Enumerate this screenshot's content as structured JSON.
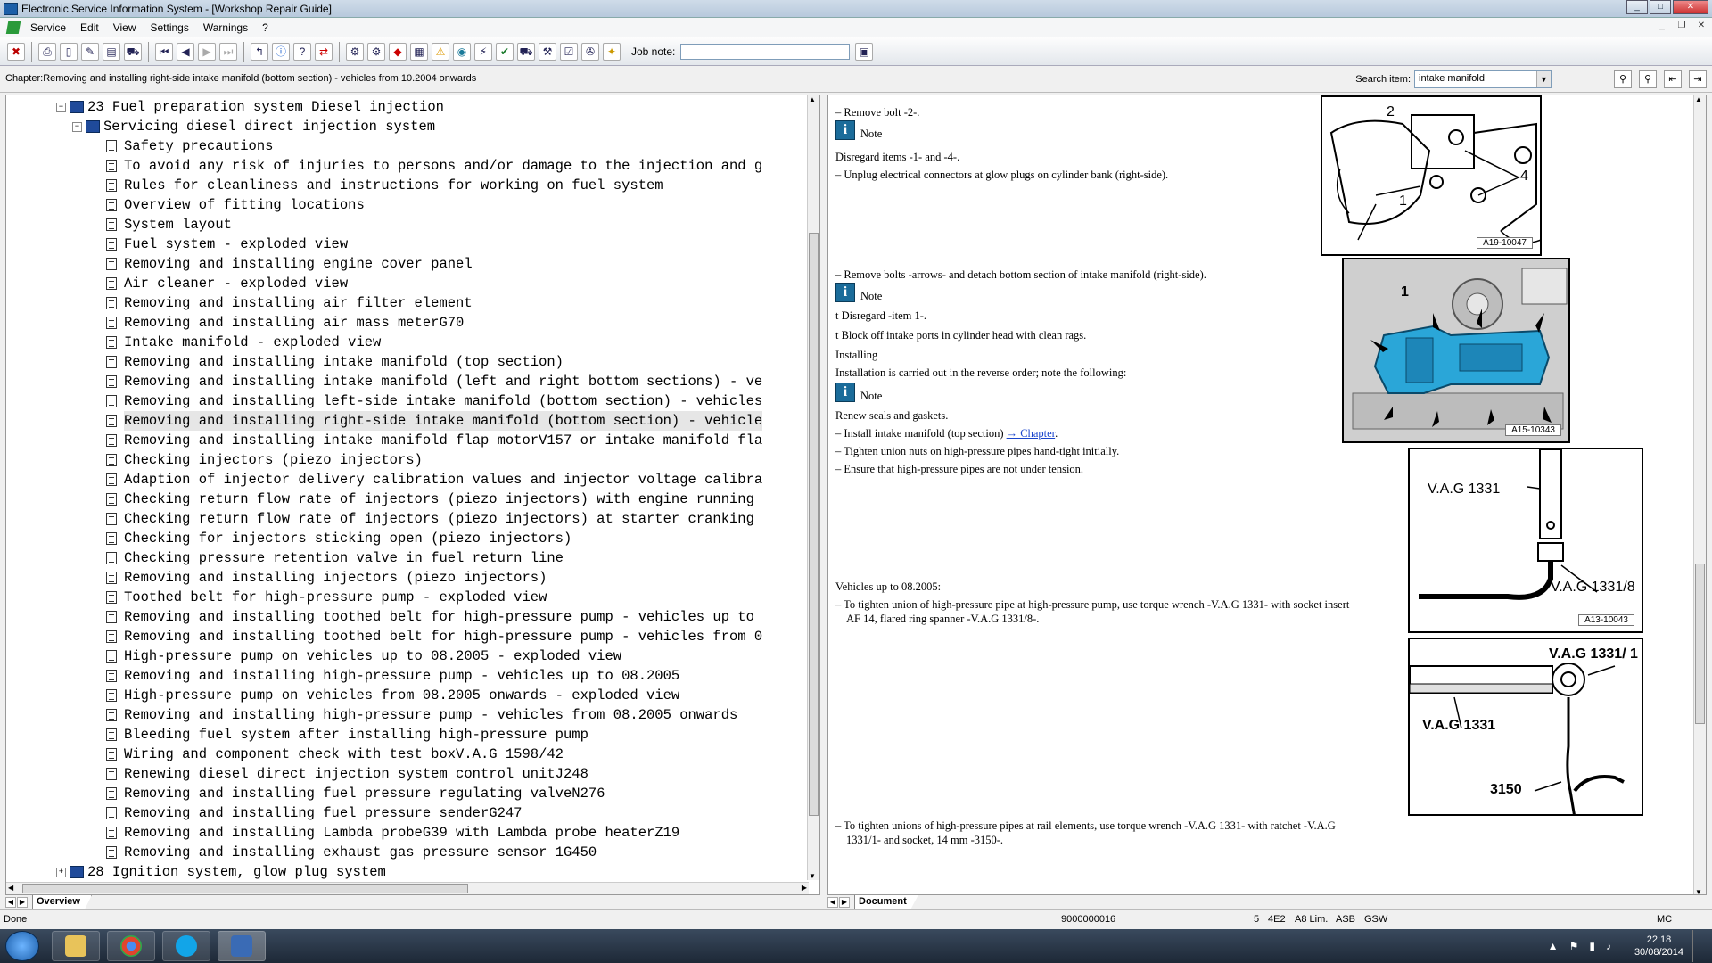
{
  "window": {
    "title": "Electronic Service Information System - [Workshop Repair Guide]"
  },
  "menu": [
    "Service",
    "Edit",
    "View",
    "Settings",
    "Warnings",
    "?"
  ],
  "toolbar": {
    "job_note_label": "Job note:",
    "job_note_value": ""
  },
  "chapter_line": "Chapter:Removing and installing right-side intake manifold (bottom section) - vehicles from 10.2004 onwards",
  "search": {
    "label": "Search item:",
    "value": "intake manifold"
  },
  "tree": {
    "group23": "23 Fuel preparation system Diesel injection",
    "sub": "Servicing diesel direct injection system",
    "items": [
      "Safety precautions",
      "To avoid any risk of injuries to persons and/or damage to the injection and g",
      "Rules for cleanliness and instructions for working on fuel system",
      "Overview of fitting locations",
      "System layout",
      "Fuel system - exploded view",
      "Removing and installing engine cover panel",
      "Air cleaner - exploded view",
      "Removing and installing air filter element",
      "Removing and installing air mass meterG70",
      "Intake manifold - exploded view",
      "Removing and installing intake manifold (top section)",
      "Removing and installing intake manifold (left and right bottom sections) - ve",
      "Removing and installing left-side intake manifold (bottom section) - vehicles",
      "Removing and installing right-side intake manifold (bottom section) - vehicle",
      "Removing and installing intake manifold flap motorV157 or intake manifold fla",
      "Checking injectors (piezo injectors)",
      "Adaption of injector delivery calibration values and injector voltage calibra",
      "Checking return flow rate of injectors (piezo injectors) with engine running",
      "Checking return flow rate of injectors (piezo injectors) at starter cranking",
      "Checking for injectors sticking open (piezo injectors)",
      "Checking pressure retention valve in fuel return line",
      "Removing and installing injectors (piezo injectors)",
      "Toothed belt for high-pressure pump - exploded view",
      "Removing and installing toothed belt for high-pressure pump - vehicles up to",
      "Removing and installing toothed belt for high-pressure pump - vehicles from 0",
      "High-pressure pump on vehicles up to 08.2005 - exploded view",
      "Removing and installing high-pressure pump - vehicles up to 08.2005",
      "High-pressure pump on vehicles from 08.2005 onwards - exploded view",
      "Removing and installing high-pressure pump - vehicles from 08.2005 onwards",
      "Bleeding fuel system after installing high-pressure pump",
      "Wiring and component check with test boxV.A.G 1598/42",
      "Renewing diesel direct injection system control unitJ248",
      "Removing and installing fuel pressure regulating valveN276",
      "Removing and installing fuel pressure senderG247",
      "Removing and installing Lambda probeG39 with Lambda probe heaterZ19",
      "Removing and installing exhaust gas pressure sensor 1G450"
    ],
    "group28": "28 Ignition system, glow plug system"
  },
  "left_tab": "Overview",
  "right_tab": "Document",
  "doc": {
    "l1": "– Remove bolt -2-.",
    "note": "Note",
    "l2": "Disregard items -1- and -4-.",
    "l3": "– Unplug electrical connectors at glow plugs on cylinder bank (right-side).",
    "l4": "– Remove bolts -arrows- and detach bottom section of intake manifold (right-side).",
    "l5": "t  Disregard -item 1-.",
    "l6": "t  Block off intake ports in cylinder head with clean rags.",
    "l7": "Installing",
    "l8": "Installation is carried out in the reverse order; note the following:",
    "l9": "Renew seals and gaskets.",
    "l10a": "– Install intake manifold (top section) ",
    "l10b": "→ Chapter",
    "l10c": ".",
    "l11": "– Tighten union nuts on high-pressure pipes hand-tight initially.",
    "l12": "– Ensure that high-pressure pipes are not under tension.",
    "l13": "Vehicles up to 08.2005:",
    "l14": "– To tighten union of high-pressure pipe at high-pressure pump, use torque wrench -V.A.G 1331- with socket insert",
    "l15": "AF 14, flared ring spanner -V.A.G 1331/8-.",
    "l16": "– To tighten unions of high-pressure pipes at rail elements, use torque wrench -V.A.G 1331- with ratchet -V.A.G",
    "l17": "1331/1- and socket, 14 mm -3150-."
  },
  "figures": {
    "f1": {
      "caption": "A19-10047",
      "labels": [
        "2",
        "1",
        "4"
      ]
    },
    "f2": {
      "caption": "A15-10343",
      "labels": [
        "1"
      ]
    },
    "f3": {
      "caption": "A13-10043",
      "labels": [
        "V.A.G  1331",
        "V.A.G  1331/8"
      ]
    },
    "f4": {
      "labels": [
        "V.A.G 1331/ 1",
        "V.A.G 1331",
        "3150"
      ]
    }
  },
  "status": {
    "left": "Done",
    "id": "9000000016",
    "f1": "5",
    "f2": "4E2",
    "f3": "A8 Lim.",
    "f4": "ASB",
    "f5": "GSW",
    "f6": "MC"
  },
  "clock": {
    "time": "22:18",
    "date": "30/08/2014"
  },
  "colors": {
    "manifold": "#2aa6d8",
    "tree_book": "#1f4a9a",
    "note_icon": "#1b6c9a"
  }
}
